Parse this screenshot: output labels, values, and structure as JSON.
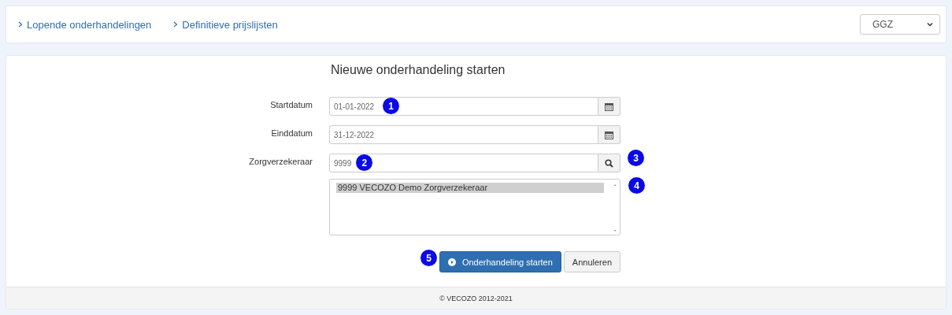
{
  "nav": {
    "links": [
      {
        "label": "Lopende onderhandelingen"
      },
      {
        "label": "Definitieve prijslijsten"
      }
    ],
    "domain_select": {
      "value": "GGZ"
    }
  },
  "form": {
    "title": "Nieuwe onderhandeling starten",
    "fields": [
      {
        "label": "Startdatum",
        "value": "01-01-2022",
        "kind": "date",
        "marker": "1"
      },
      {
        "label": "Einddatum",
        "value": "31-12-2022",
        "kind": "date"
      },
      {
        "label": "Zorgverzekeraar",
        "value": "9999",
        "kind": "search",
        "marker": "2",
        "button_marker": "3"
      }
    ],
    "results": {
      "marker": "4",
      "options": [
        {
          "label": "9999 VECOZO Demo Zorgverzekeraar",
          "selected": true
        }
      ]
    },
    "actions": {
      "marker": "5",
      "primary": "Onderhandeling starten",
      "secondary": "Annuleren"
    }
  },
  "footer": "© VECOZO 2012-2021"
}
